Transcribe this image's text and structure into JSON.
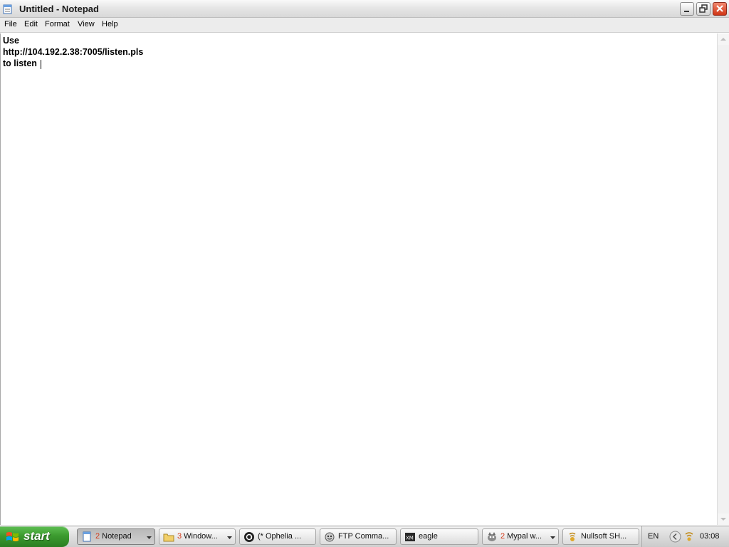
{
  "window": {
    "title": "Untitled - Notepad",
    "icon": "notepad-icon"
  },
  "menu": {
    "file": "File",
    "edit": "Edit",
    "format": "Format",
    "view": "View",
    "help": "Help"
  },
  "document": {
    "lines": [
      "Use",
      "http://104.192.2.38:7005/listen.pls",
      "to listen"
    ]
  },
  "taskbar": {
    "start_label": "start",
    "tasks": [
      {
        "label": "Notepad",
        "count": "2",
        "icon": "notepad-icon"
      },
      {
        "label": "Window...",
        "count": "3",
        "icon": "folder-icon"
      },
      {
        "label": "(* Ophelia ...",
        "icon": "audio-circle-icon"
      },
      {
        "label": "FTP Comma...",
        "icon": "ftp-icon"
      },
      {
        "label": "eagle",
        "icon": "xm-icon"
      },
      {
        "label": "Mypal w...",
        "count": "2",
        "icon": "browser-icon"
      },
      {
        "label": "Nullsoft SH...",
        "icon": "shoutcast-icon"
      }
    ],
    "tray": {
      "language": "EN",
      "clock": "03:08"
    }
  },
  "colors": {
    "start_green": "#3c9b2f",
    "close_red": "#cf3515",
    "task_count_red": "#d33a1a"
  }
}
